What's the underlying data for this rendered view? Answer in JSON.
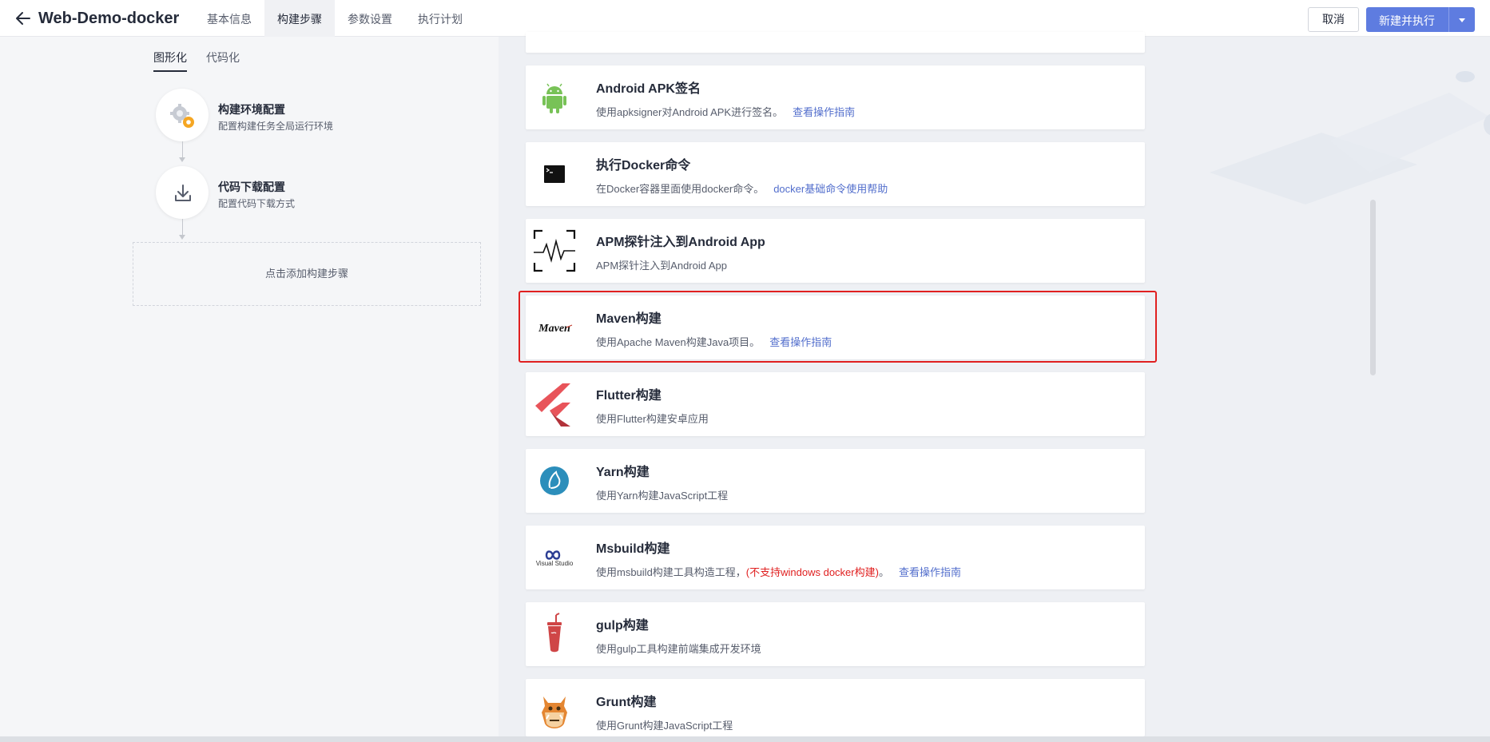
{
  "header": {
    "app_title": "Web-Demo-docker",
    "tabs": [
      {
        "label": "基本信息"
      },
      {
        "label": "构建步骤"
      },
      {
        "label": "参数设置"
      },
      {
        "label": "执行计划"
      }
    ],
    "active_tab": "构建步骤",
    "cancel_label": "取消",
    "run_label": "新建并执行"
  },
  "left": {
    "mode_tabs": [
      {
        "label": "图形化"
      },
      {
        "label": "代码化"
      }
    ],
    "active_mode": "图形化",
    "steps": [
      {
        "title": "构建环境配置",
        "desc": "配置构建任务全局运行环境",
        "icon": "gears-icon"
      },
      {
        "title": "代码下载配置",
        "desc": "配置代码下载方式",
        "icon": "download-icon"
      }
    ],
    "add_step_label": "点击添加构建步骤"
  },
  "cards": [
    {
      "title": "Android APK签名",
      "desc": "使用apksigner对Android APK进行签名。",
      "link": "查看操作指南",
      "icon": "android-icon"
    },
    {
      "title": "执行Docker命令",
      "desc": "在Docker容器里面使用docker命令。",
      "link": "docker基础命令使用帮助",
      "icon": "terminal-icon"
    },
    {
      "title": "APM探针注入到Android App",
      "desc": "APM探针注入到Android App",
      "icon": "apm-icon"
    },
    {
      "title": "Maven构建",
      "desc": "使用Apache Maven构建Java项目。",
      "link": "查看操作指南",
      "icon": "maven-icon",
      "icon_text": "Maven",
      "highlighted": true
    },
    {
      "title": "Flutter构建",
      "desc": "使用Flutter构建安卓应用",
      "icon": "flutter-icon"
    },
    {
      "title": "Yarn构建",
      "desc": "使用Yarn构建JavaScript工程",
      "icon": "yarn-icon"
    },
    {
      "title": "Msbuild构建",
      "desc": "使用msbuild构建工具构造工程，",
      "warning": "(不支持windows docker构建)",
      "desc_suffix": "。",
      "link": "查看操作指南",
      "icon": "visual-studio-icon",
      "icon_text": "Visual Studio"
    },
    {
      "title": "gulp构建",
      "desc": "使用gulp工具构建前端集成开发环境",
      "icon": "gulp-icon"
    },
    {
      "title": "Grunt构建",
      "desc": "使用Grunt构建JavaScript工程",
      "icon": "grunt-icon"
    }
  ],
  "colors": {
    "primary": "#5e7ce0",
    "link": "#526ecc",
    "highlight": "#e02020",
    "android": "#78c257",
    "flutter": "#e8545a",
    "yarn": "#2c8ebb",
    "gulp": "#cf4647"
  }
}
